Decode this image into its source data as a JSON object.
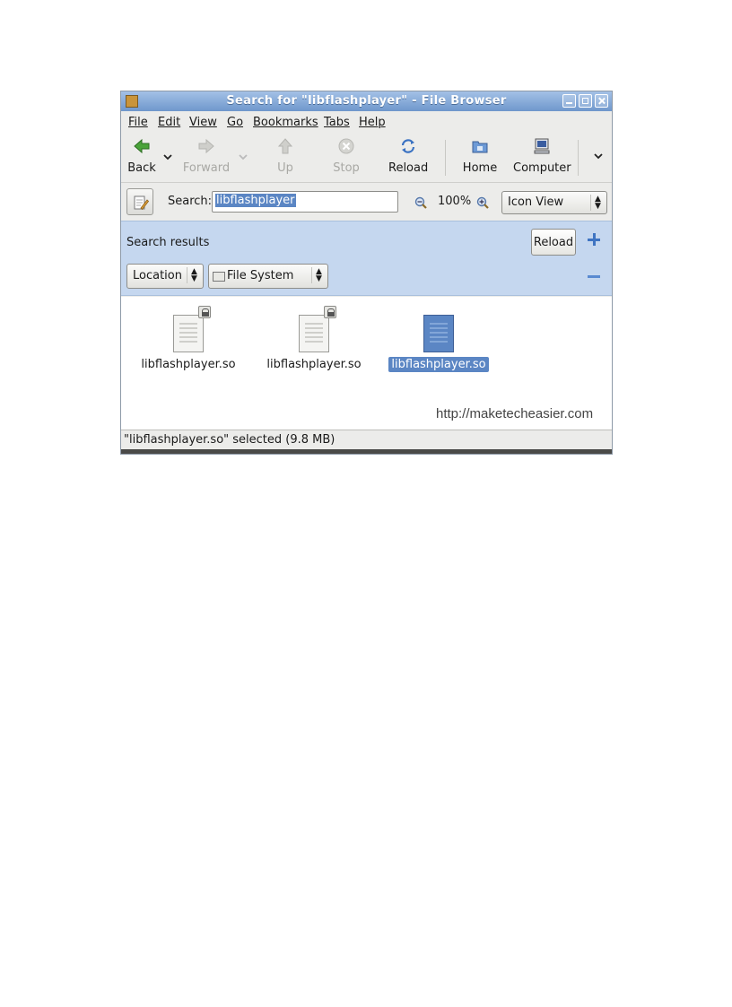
{
  "window": {
    "title": "Search for \"libflashplayer\" - File Browser"
  },
  "menu": [
    "File",
    "Edit",
    "View",
    "Go",
    "Bookmarks",
    "Tabs",
    "Help"
  ],
  "toolbar": {
    "back": "Back",
    "forward": "Forward",
    "up": "Up",
    "stop": "Stop",
    "reload": "Reload",
    "home": "Home",
    "computer": "Computer"
  },
  "search": {
    "label": "Search:",
    "value": "libflashplayer",
    "zoom": "100%",
    "view": "Icon View"
  },
  "results": {
    "title": "Search results",
    "reload_label": "Reload",
    "location_label": "Location",
    "filesystem_label": "File System"
  },
  "files": [
    {
      "name": "libflashplayer.so",
      "selected": false,
      "locked": true
    },
    {
      "name": "libflashplayer.so",
      "selected": false,
      "locked": true
    },
    {
      "name": "libflashplayer.so",
      "selected": true,
      "locked": false
    }
  ],
  "watermark": "http://maketecheasier.com",
  "status": "\"libflashplayer.so\" selected (9.8 MB)",
  "colors": {
    "titlebar": "#6f97cc",
    "selection": "#5b86c4",
    "results_pane": "#c5d7ef"
  }
}
